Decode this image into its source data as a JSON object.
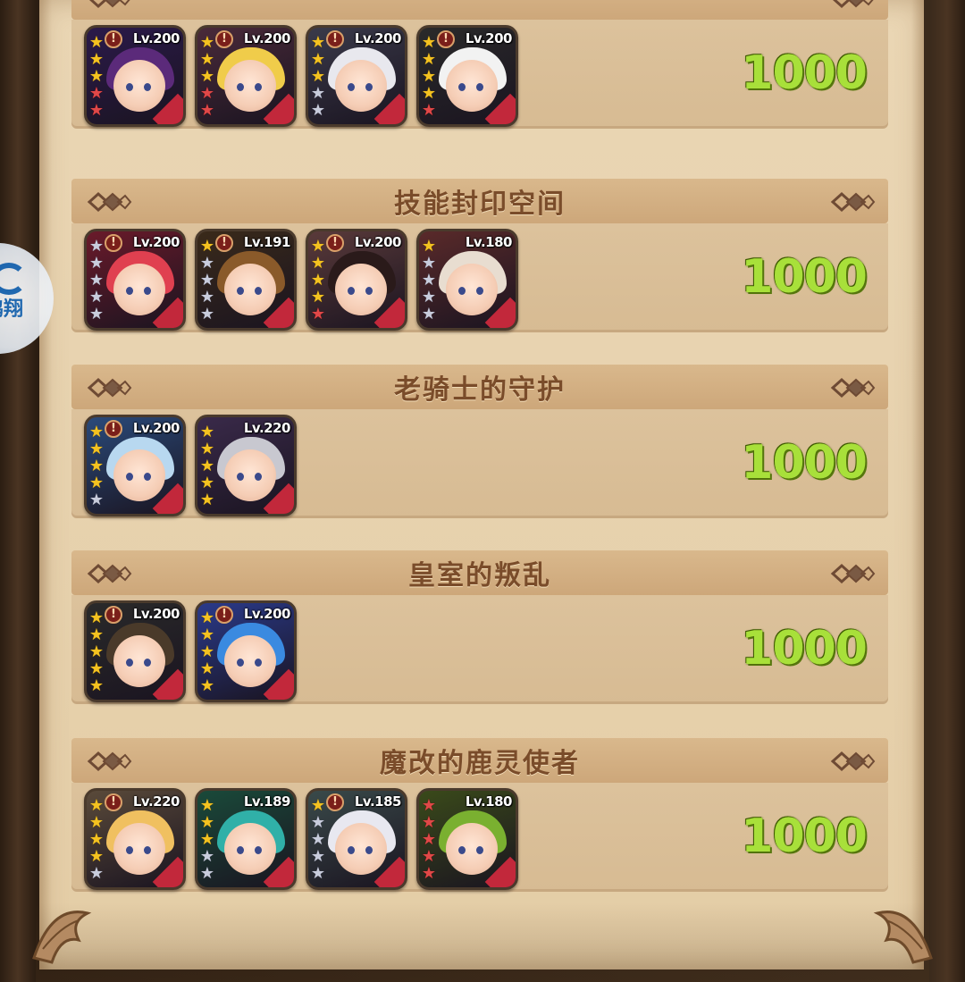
{
  "sections": [
    {
      "title": "",
      "score": "1000",
      "heroes": [
        {
          "level": "Lv.200",
          "alert": true,
          "stars": [
            "gold",
            "gold",
            "gold",
            "red",
            "red"
          ],
          "hair": "#5b2a7a",
          "bg": "#2b1a4a"
        },
        {
          "level": "Lv.200",
          "alert": true,
          "stars": [
            "gold",
            "gold",
            "gold",
            "red",
            "red"
          ],
          "hair": "#f0cc4a",
          "bg": "#4a2a3a"
        },
        {
          "level": "Lv.200",
          "alert": true,
          "stars": [
            "gold",
            "gold",
            "gold",
            "silver",
            "silver"
          ],
          "hair": "#e8e8ee",
          "bg": "#3a3a4a"
        },
        {
          "level": "Lv.200",
          "alert": true,
          "stars": [
            "gold",
            "gold",
            "gold",
            "gold",
            "red"
          ],
          "hair": "#f2f2f2",
          "bg": "#2a2a2a"
        }
      ]
    },
    {
      "title": "技能封印空间",
      "score": "1000",
      "heroes": [
        {
          "level": "Lv.200",
          "alert": true,
          "stars": [
            "silver",
            "silver",
            "silver",
            "silver",
            "silver"
          ],
          "hair": "#e04050",
          "bg": "#6a1a2a"
        },
        {
          "level": "Lv.191",
          "alert": true,
          "stars": [
            "gold",
            "silver",
            "silver",
            "silver",
            "silver"
          ],
          "hair": "#8a5a2a",
          "bg": "#3a2a1a"
        },
        {
          "level": "Lv.200",
          "alert": true,
          "stars": [
            "gold",
            "gold",
            "gold",
            "gold",
            "red"
          ],
          "hair": "#2a1a1a",
          "bg": "#5a3a3a"
        },
        {
          "level": "Lv.180",
          "alert": false,
          "stars": [
            "gold",
            "silver",
            "silver",
            "silver",
            "silver"
          ],
          "hair": "#e8ddd0",
          "bg": "#5a2a2a"
        }
      ]
    },
    {
      "title": "老骑士的守护",
      "score": "1000",
      "heroes": [
        {
          "level": "Lv.200",
          "alert": true,
          "stars": [
            "gold",
            "gold",
            "gold",
            "gold",
            "silver"
          ],
          "hair": "#b8d8f0",
          "bg": "#2a4a7a"
        },
        {
          "level": "Lv.220",
          "alert": false,
          "stars": [
            "gold",
            "gold",
            "gold",
            "gold",
            "gold"
          ],
          "hair": "#c8c8d0",
          "bg": "#3a2a4a"
        }
      ]
    },
    {
      "title": "皇室的叛乱",
      "score": "1000",
      "heroes": [
        {
          "level": "Lv.200",
          "alert": true,
          "stars": [
            "gold",
            "gold",
            "gold",
            "gold",
            "gold"
          ],
          "hair": "#4a3a2a",
          "bg": "#2a2a2a"
        },
        {
          "level": "Lv.200",
          "alert": true,
          "stars": [
            "gold",
            "gold",
            "gold",
            "gold",
            "gold"
          ],
          "hair": "#3a8ae0",
          "bg": "#2a3a8a"
        }
      ]
    },
    {
      "title": "魔改的鹿灵使者",
      "score": "1000",
      "heroes": [
        {
          "level": "Lv.220",
          "alert": true,
          "stars": [
            "gold",
            "gold",
            "gold",
            "gold",
            "silver"
          ],
          "hair": "#f0c060",
          "bg": "#5a4a3a"
        },
        {
          "level": "Lv.189",
          "alert": false,
          "stars": [
            "gold",
            "gold",
            "gold",
            "silver",
            "silver"
          ],
          "hair": "#30b0a8",
          "bg": "#1a4a3a"
        },
        {
          "level": "Lv.185",
          "alert": true,
          "stars": [
            "gold",
            "silver",
            "silver",
            "silver",
            "silver"
          ],
          "hair": "#e8e8f0",
          "bg": "#3a4a4a"
        },
        {
          "level": "Lv.180",
          "alert": false,
          "stars": [
            "red",
            "red",
            "red",
            "red",
            "red"
          ],
          "hair": "#7ab030",
          "bg": "#3a4a1a"
        }
      ]
    }
  ],
  "side_badge_text": "鹏翔",
  "colors": {
    "score": "#a8e03a",
    "header_text": "#7a4c2a",
    "parchment": "#e7d2ae",
    "badge_corner": "#c2283b"
  },
  "icons": {
    "alert": "exclamation-icon",
    "star": "star-icon",
    "ornament": "diamond-ornament-icon"
  }
}
